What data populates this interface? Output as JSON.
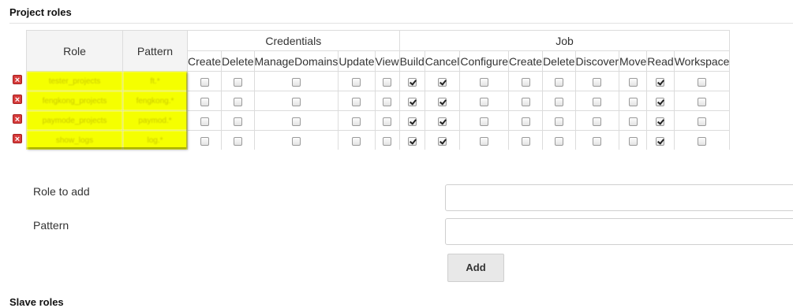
{
  "section_title": "Project roles",
  "table": {
    "role_header": "Role",
    "pattern_header": "Pattern",
    "groups": [
      {
        "label": "Credentials",
        "perms": [
          "Create",
          "Delete",
          "ManageDomains",
          "Update",
          "View"
        ]
      },
      {
        "label": "Job",
        "perms": [
          "Build",
          "Cancel",
          "Configure",
          "Create",
          "Delete",
          "Discover",
          "Move",
          "Read",
          "Workspace"
        ]
      }
    ],
    "rows": [
      {
        "role": "tester_projects",
        "pattern": "ft.*",
        "checks": [
          false,
          false,
          false,
          false,
          false,
          true,
          true,
          false,
          false,
          false,
          false,
          false,
          true,
          false
        ]
      },
      {
        "role": "fengkong_projects",
        "pattern": "fengkong.*",
        "checks": [
          false,
          false,
          false,
          false,
          false,
          true,
          true,
          false,
          false,
          false,
          false,
          false,
          true,
          false
        ]
      },
      {
        "role": "paymode_projects",
        "pattern": "paymod.*",
        "checks": [
          false,
          false,
          false,
          false,
          false,
          true,
          true,
          false,
          false,
          false,
          false,
          false,
          true,
          false
        ]
      },
      {
        "role": "show_logs",
        "pattern": "log.*",
        "checks": [
          false,
          false,
          false,
          false,
          false,
          true,
          true,
          false,
          false,
          false,
          false,
          false,
          true,
          false
        ]
      }
    ]
  },
  "form": {
    "role_label": "Role to add",
    "pattern_label": "Pattern",
    "role_value": "",
    "pattern_value": "",
    "add_button": "Add"
  },
  "next_section_title": "Slave roles",
  "colors": {
    "highlight": "#f5ff00",
    "delete_icon": "#d63c3c"
  },
  "icons": {
    "remove": "remove-role-icon"
  }
}
